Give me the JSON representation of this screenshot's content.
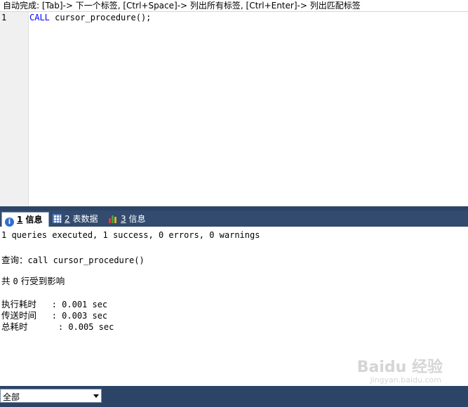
{
  "hint_bar": {
    "text": "自动完成: [Tab]-> 下一个标签, [Ctrl+Space]-> 列出所有标签, [Ctrl+Enter]-> 列出匹配标签"
  },
  "editor": {
    "line_number": "1",
    "keyword": "CALL",
    "code_rest": " cursor_procedure();"
  },
  "tabs": [
    {
      "num": "1",
      "label": " 信息",
      "icon": "info-icon",
      "active": true
    },
    {
      "num": "2",
      "label": " 表数据",
      "icon": "table-grid-icon",
      "active": false
    },
    {
      "num": "3",
      "label": " 信息",
      "icon": "bar-chart-icon",
      "active": false
    }
  ],
  "output": {
    "summary": "1 queries executed, 1 success, 0 errors, 0 warnings",
    "query_label": "查询：",
    "query_text": "call cursor_procedure()",
    "affected_prefix": "共 ",
    "affected_count": "0",
    "affected_suffix": " 行受到影响",
    "exec_label": "执行耗时",
    "exec_value": "   : 0.001 sec",
    "transfer_label": "传送时间",
    "transfer_value": "   : 0.003 sec",
    "total_label": "总耗时",
    "total_value": "      : 0.005 sec"
  },
  "filter": {
    "selected": "全部"
  },
  "watermark": {
    "main": "Baidu 经验",
    "sub": "jingyan.baidu.com"
  },
  "colors": {
    "panel_dark": "#2c4566",
    "keyword": "#0000ff"
  }
}
